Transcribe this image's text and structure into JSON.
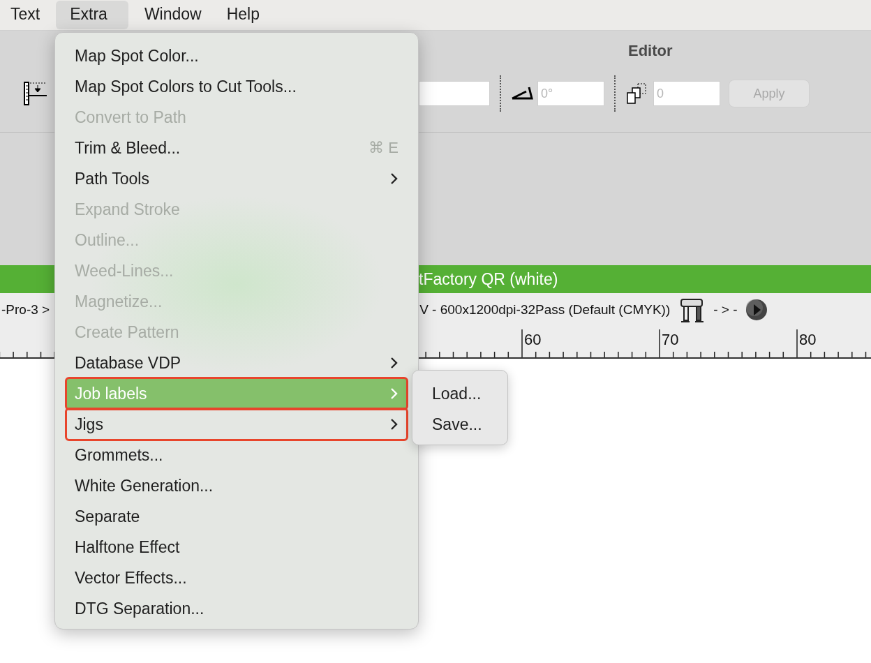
{
  "menu_bar": [
    {
      "label": "Text",
      "selected": false
    },
    {
      "label": "Extra",
      "selected": true
    },
    {
      "label": "Window",
      "selected": false
    },
    {
      "label": "Help",
      "selected": false
    }
  ],
  "toolbar": {
    "title": "Editor",
    "angle_field": {
      "placeholder": "0°"
    },
    "copies_field": {
      "placeholder": "0"
    },
    "apply_button": {
      "label": "Apply",
      "disabled": true
    }
  },
  "green_bar": {
    "text": "tFactory QR (white)"
  },
  "status_row": {
    "left_text": "-Pro-3 >",
    "device_text": "V - 600x1200dpi-32Pass (Default (CMYK))",
    "arrow_text": "- > -"
  },
  "ruler": {
    "labels": [
      "60",
      "70",
      "80"
    ]
  },
  "menu": {
    "items": [
      {
        "kind": "item",
        "label": "Map Spot Color...",
        "disabled": false,
        "selected": false,
        "outlined": false
      },
      {
        "kind": "item",
        "label": "Map Spot Colors to Cut Tools...",
        "disabled": false,
        "selected": false,
        "outlined": false
      },
      {
        "kind": "item",
        "label": "Convert to Path",
        "disabled": true,
        "selected": false,
        "outlined": false
      },
      {
        "kind": "item",
        "label": "Trim & Bleed...",
        "shortcut": "⌘ E",
        "disabled": false,
        "selected": false,
        "outlined": false
      },
      {
        "kind": "submenu",
        "label": "Path Tools",
        "disabled": false,
        "selected": false,
        "outlined": false
      },
      {
        "kind": "item",
        "label": "Expand Stroke",
        "disabled": true,
        "selected": false,
        "outlined": false
      },
      {
        "kind": "item",
        "label": "Outline...",
        "disabled": true,
        "selected": false,
        "outlined": false
      },
      {
        "kind": "item",
        "label": "Weed-Lines...",
        "disabled": true,
        "selected": false,
        "outlined": false
      },
      {
        "kind": "item",
        "label": "Magnetize...",
        "disabled": true,
        "selected": false,
        "outlined": false
      },
      {
        "kind": "item",
        "label": "Create Pattern",
        "disabled": true,
        "selected": false,
        "outlined": false
      },
      {
        "kind": "submenu",
        "label": "Database VDP",
        "disabled": false,
        "selected": false,
        "outlined": false
      },
      {
        "kind": "submenu",
        "label": "Job labels",
        "disabled": false,
        "selected": true,
        "outlined": true
      },
      {
        "kind": "submenu",
        "label": "Jigs",
        "disabled": false,
        "selected": false,
        "outlined": true
      },
      {
        "kind": "item",
        "label": "Grommets...",
        "disabled": false,
        "selected": false,
        "outlined": false
      },
      {
        "kind": "item",
        "label": "White Generation...",
        "disabled": false,
        "selected": false,
        "outlined": false
      },
      {
        "kind": "item",
        "label": "Separate",
        "disabled": false,
        "selected": false,
        "outlined": false
      },
      {
        "kind": "item",
        "label": "Halftone Effect",
        "disabled": false,
        "selected": false,
        "outlined": false
      },
      {
        "kind": "item",
        "label": "Vector Effects...",
        "disabled": false,
        "selected": false,
        "outlined": false
      },
      {
        "kind": "item",
        "label": "DTG Separation...",
        "disabled": false,
        "selected": false,
        "outlined": false
      }
    ]
  },
  "submenu": {
    "items": [
      {
        "label": "Load...",
        "selected": false
      },
      {
        "label": "Save...",
        "selected": false
      }
    ]
  }
}
